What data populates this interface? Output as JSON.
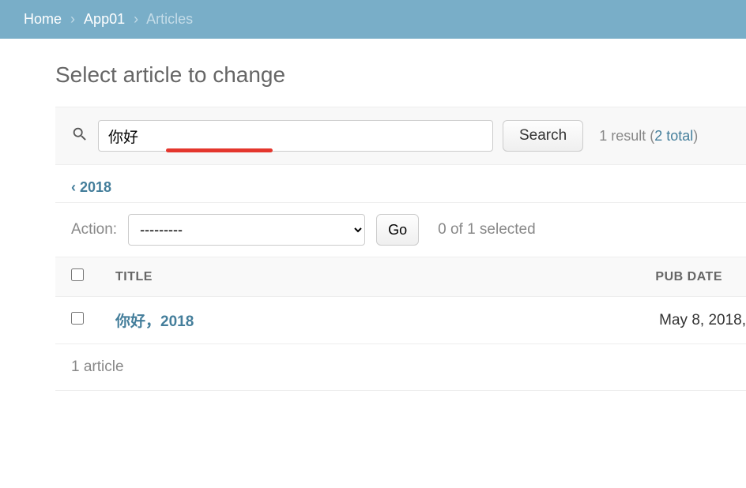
{
  "breadcrumb": {
    "home": "Home",
    "app": "App01",
    "current": "Articles"
  },
  "page_title": "Select article to change",
  "search": {
    "value": "你好",
    "button": "Search",
    "result_prefix": "1 result (",
    "total_link": "2 total",
    "result_suffix": ")"
  },
  "filter": {
    "year_link": "‹ 2018"
  },
  "actions": {
    "label": "Action:",
    "placeholder": "---------",
    "go": "Go",
    "selected": "0 of 1 selected"
  },
  "table": {
    "headers": {
      "title": "TITLE",
      "pub_date": "PUB DATE"
    },
    "rows": [
      {
        "title": "你好，2018",
        "pub_date": "May 8, 2018,"
      }
    ]
  },
  "footer": "1 article"
}
